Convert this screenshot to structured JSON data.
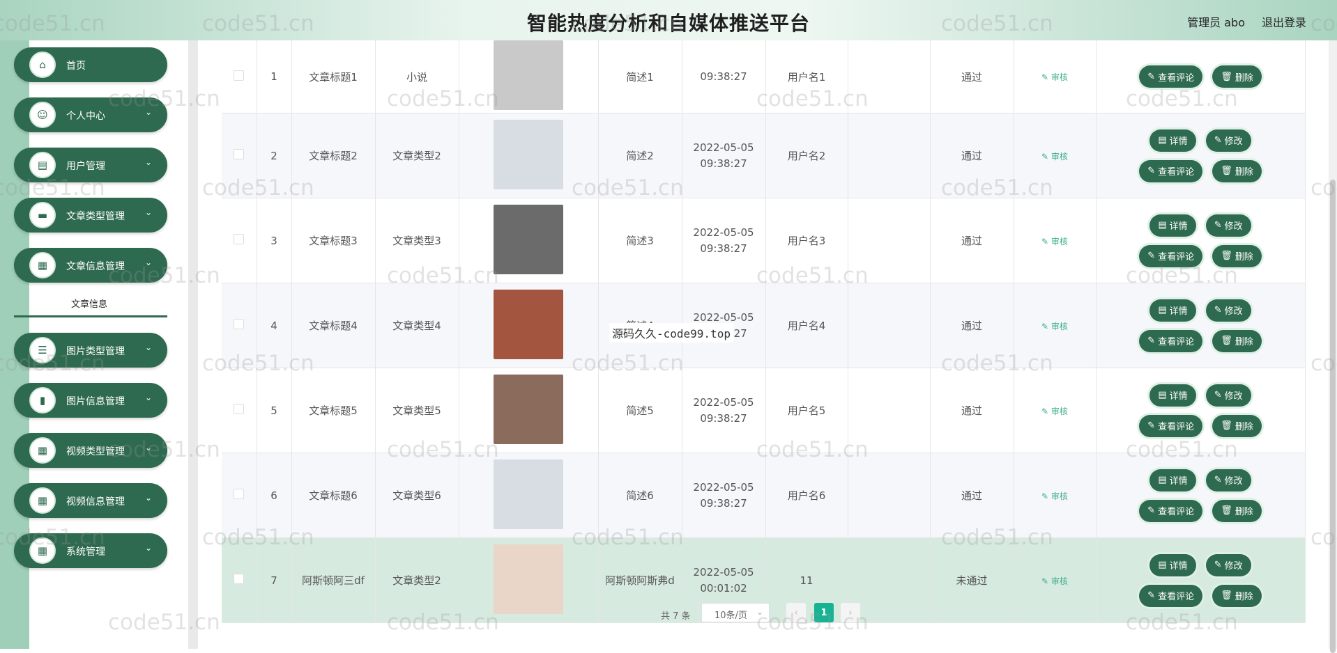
{
  "header": {
    "title": "智能热度分析和自媒体推送平台",
    "user": "管理员 abo",
    "logout": "退出登录"
  },
  "sidebar": {
    "items": [
      {
        "label": "首页",
        "icon": "home-icon",
        "glyph": "⌂",
        "expandable": false
      },
      {
        "label": "个人中心",
        "icon": "person-icon",
        "glyph": "☺",
        "expandable": true
      },
      {
        "label": "用户管理",
        "icon": "clipboard-icon",
        "glyph": "▤",
        "expandable": true
      },
      {
        "label": "文章类型管理",
        "icon": "monitor-icon",
        "glyph": "▬",
        "expandable": true
      },
      {
        "label": "文章信息管理",
        "icon": "grid-icon",
        "glyph": "▦",
        "expandable": true
      },
      {
        "label": "图片类型管理",
        "icon": "list-icon",
        "glyph": "☰",
        "expandable": true
      },
      {
        "label": "图片信息管理",
        "icon": "bar-chart-icon",
        "glyph": "▮",
        "expandable": true
      },
      {
        "label": "视频类型管理",
        "icon": "grid-icon",
        "glyph": "▦",
        "expandable": true
      },
      {
        "label": "视频信息管理",
        "icon": "grid-icon",
        "glyph": "▦",
        "expandable": true
      },
      {
        "label": "系统管理",
        "icon": "grid-icon",
        "glyph": "▦",
        "expandable": true
      }
    ],
    "active_sub": "文章信息"
  },
  "table": {
    "rows": [
      {
        "idx": "1",
        "title": "文章标题1",
        "type": "小说",
        "summary": "简述1",
        "date": "",
        "time": "09:38:27",
        "user": "用户名1",
        "status": "通过",
        "img": "#c9c9c9"
      },
      {
        "idx": "2",
        "title": "文章标题2",
        "type": "文章类型2",
        "summary": "简述2",
        "date": "2022-05-05",
        "time": "09:38:27",
        "user": "用户名2",
        "status": "通过",
        "img": "#d7dde3"
      },
      {
        "idx": "3",
        "title": "文章标题3",
        "type": "文章类型3",
        "summary": "简述3",
        "date": "2022-05-05",
        "time": "09:38:27",
        "user": "用户名3",
        "status": "通过",
        "img": "#6b6b6b"
      },
      {
        "idx": "4",
        "title": "文章标题4",
        "type": "文章类型4",
        "summary": "简述4",
        "date": "2022-05-05",
        "time": "09:38:27",
        "user": "用户名4",
        "status": "通过",
        "img": "#a45540"
      },
      {
        "idx": "5",
        "title": "文章标题5",
        "type": "文章类型5",
        "summary": "简述5",
        "date": "2022-05-05",
        "time": "09:38:27",
        "user": "用户名5",
        "status": "通过",
        "img": "#8a6b5c"
      },
      {
        "idx": "6",
        "title": "文章标题6",
        "type": "文章类型6",
        "summary": "简述6",
        "date": "2022-05-05",
        "time": "09:38:27",
        "user": "用户名6",
        "status": "通过",
        "img": "#d7dde3"
      },
      {
        "idx": "7",
        "title": "阿斯顿阿三df",
        "type": "文章类型2",
        "summary": "阿斯顿阿斯弗d",
        "date": "2022-05-05",
        "time": "00:01:02",
        "user": "11",
        "status": "未通过",
        "img": "#e9d6c8"
      }
    ],
    "audit_label": "审核",
    "btn_detail": "详情",
    "btn_edit": "修改",
    "btn_comments": "查看评论",
    "btn_delete": "删除"
  },
  "pager": {
    "total": "共 7 条",
    "size": "10条/页",
    "current": "1"
  },
  "watermark": {
    "text": "code51.cn",
    "center": "源码久久-code99.top"
  }
}
